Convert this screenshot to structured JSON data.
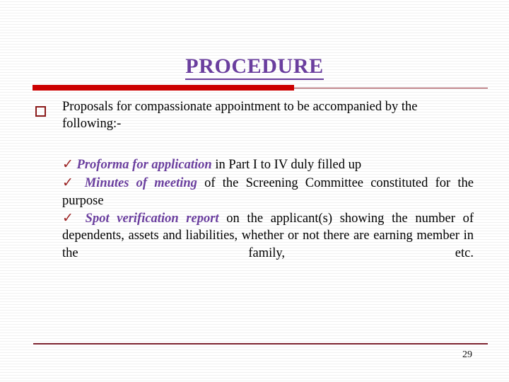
{
  "slide": {
    "title": "PROCEDURE",
    "page_number": "29",
    "accent_purple": "#6A3E9E",
    "accent_red": "#CC0000",
    "marker_maroon": "#8B1A1A",
    "rule_maroon": "#7D2430",
    "body_color": "#000000",
    "background": "#FFFFFF"
  },
  "content": {
    "intro": {
      "marker": "hollow-square",
      "text": "Proposals for compassionate appointment to be accompanied by the following:-"
    },
    "items": [
      {
        "marker": "check",
        "lead": "Proforma for application",
        "rest": " in Part I to IV duly filled up"
      },
      {
        "marker": "check",
        "lead": "Minutes of meeting",
        "rest": " of the Screening Committee constituted for the purpose"
      },
      {
        "marker": "check",
        "lead": "Spot verification report",
        "rest": " on the applicant(s) showing the number of dependents, assets and liabilities, whether or not there are earning member in the family, etc."
      }
    ]
  },
  "glyphs": {
    "check": "✓"
  }
}
